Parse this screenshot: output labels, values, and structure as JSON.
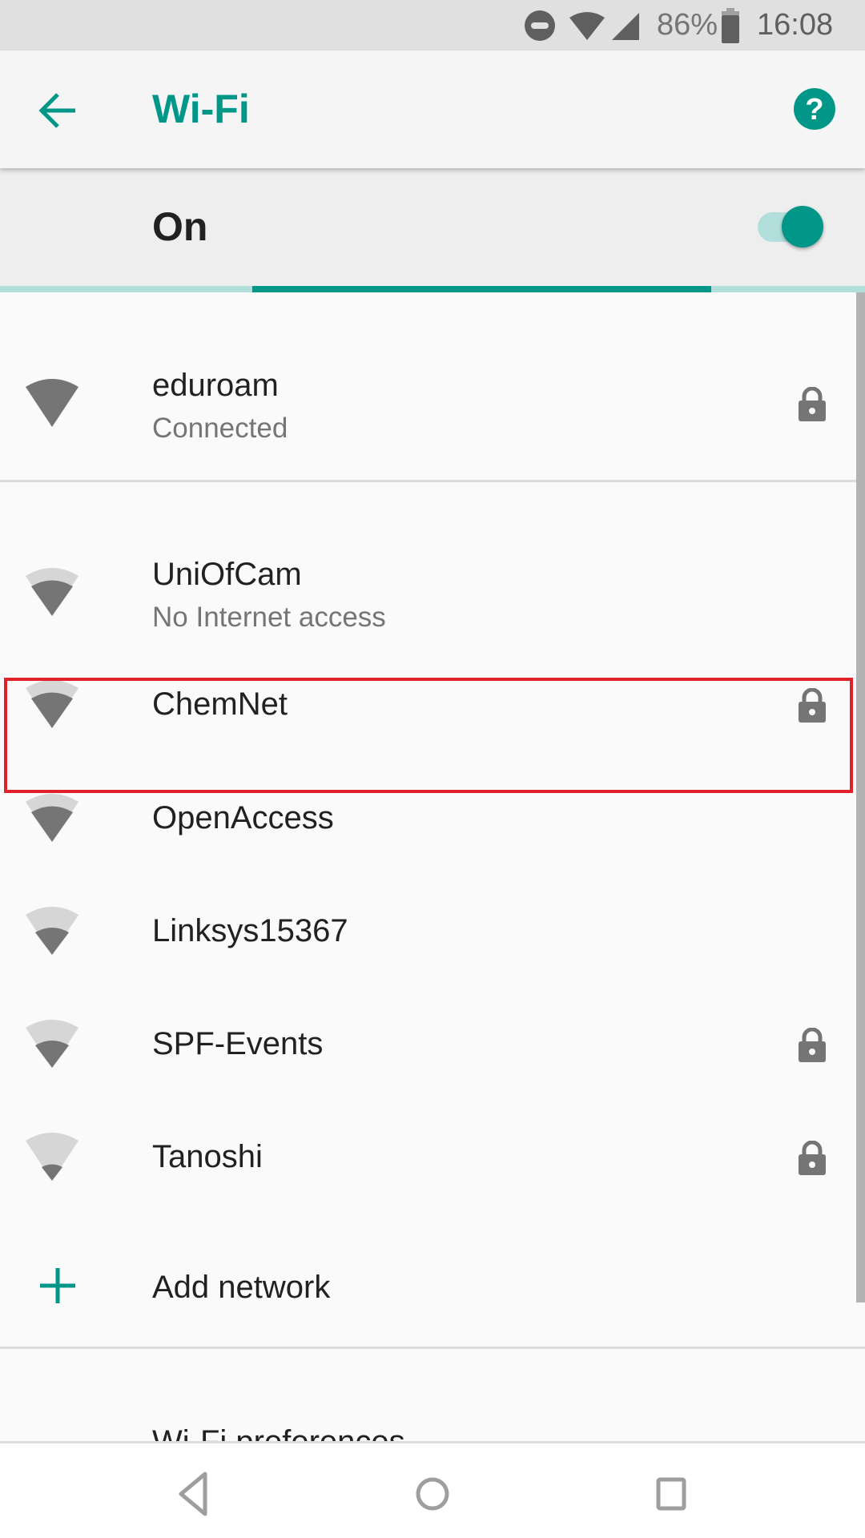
{
  "status_bar": {
    "dnd_icon": "do-not-disturb-icon",
    "wifi_icon": "wifi-signal-icon",
    "cell_icon": "cell-signal-icon",
    "battery_percent": "86%",
    "battery_icon": "battery-icon",
    "time": "16:08"
  },
  "toolbar": {
    "back_icon": "arrow-back-icon",
    "title": "Wi-Fi",
    "help_icon": "help-icon"
  },
  "switch_bar": {
    "label": "On",
    "checked": true
  },
  "scan_progress": {
    "indeterminate": true
  },
  "connected_network": {
    "name": "eduroam",
    "status": "Connected",
    "signal_level": 4,
    "secured": true
  },
  "networks": [
    {
      "name": "UniOfCam",
      "status": "No Internet access",
      "signal_level": 3,
      "secured": false
    },
    {
      "name": "ChemNet",
      "status": "",
      "signal_level": 3,
      "secured": true,
      "highlighted": true
    },
    {
      "name": "OpenAccess",
      "status": "",
      "signal_level": 3,
      "secured": false
    },
    {
      "name": "Linksys15367",
      "status": "",
      "signal_level": 2,
      "secured": false
    },
    {
      "name": "SPF-Events",
      "status": "",
      "signal_level": 2,
      "secured": true
    },
    {
      "name": "Tanoshi",
      "status": "",
      "signal_level": 1,
      "secured": true
    }
  ],
  "add_network": {
    "icon": "plus-icon",
    "label": "Add network"
  },
  "preferences": {
    "label": "Wi-Fi preferences"
  },
  "colors": {
    "accent": "#009688",
    "accent_light": "#b2dfdb",
    "highlight": "#e0202a"
  },
  "nav_bar": {
    "back": "nav-back-icon",
    "home": "nav-home-icon",
    "recents": "nav-recents-icon"
  }
}
